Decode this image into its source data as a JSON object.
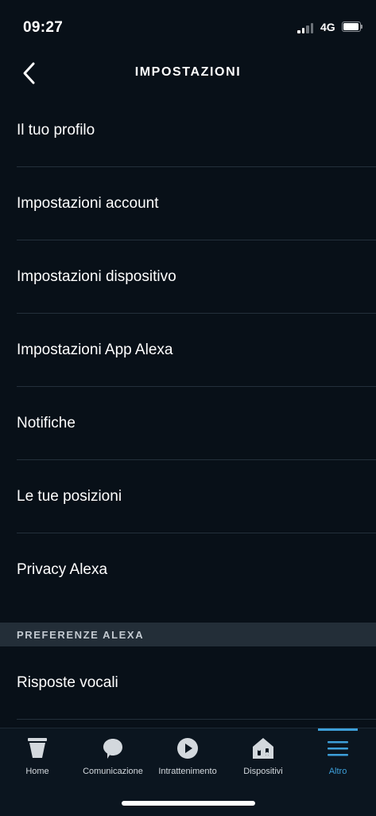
{
  "status_bar": {
    "time": "09:27",
    "network": "4G"
  },
  "header": {
    "title": "IMPOSTAZIONI",
    "back_icon": "chevron-left-icon"
  },
  "menu": {
    "items": [
      {
        "label": "Il tuo profilo"
      },
      {
        "label": "Impostazioni account"
      },
      {
        "label": "Impostazioni dispositivo"
      },
      {
        "label": "Impostazioni App Alexa"
      },
      {
        "label": "Notifiche"
      },
      {
        "label": "Le tue posizioni"
      },
      {
        "label": "Privacy Alexa"
      }
    ]
  },
  "section": {
    "title": "PREFERENZE ALEXA",
    "items": [
      {
        "label": "Risposte vocali"
      }
    ]
  },
  "tab_bar": {
    "tabs": [
      {
        "label": "Home",
        "icon": "home-icon",
        "active": false
      },
      {
        "label": "Comunicazione",
        "icon": "speech-bubble-icon",
        "active": false
      },
      {
        "label": "Intrattenimento",
        "icon": "play-icon",
        "active": false
      },
      {
        "label": "Dispositivi",
        "icon": "smart-home-icon",
        "active": false
      },
      {
        "label": "Altro",
        "icon": "hamburger-menu-icon",
        "active": true
      }
    ]
  },
  "colors": {
    "background": "#081018",
    "accent": "#3d9fd9",
    "section_bg": "#232e38",
    "divider": "#24303b"
  }
}
